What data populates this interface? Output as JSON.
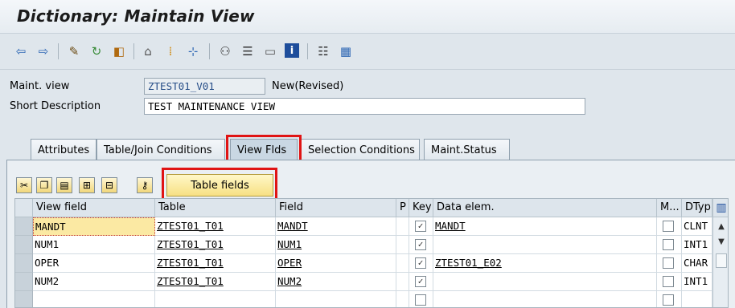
{
  "window": {
    "title": "Dictionary: Maintain View"
  },
  "toolbar": {
    "icons": [
      "back-arrow-icon",
      "forward-arrow-icon",
      "other-object-icon",
      "display-change-icon",
      "activate-icon",
      "where-used-icon",
      "object-list-icon",
      "navigation-icon",
      "hierarchy-icon",
      "technical-settings-icon",
      "documentation-icon",
      "info-icon",
      "check-icon",
      "table-view-icon"
    ]
  },
  "form": {
    "maint_view_label": "Maint. view",
    "maint_view_value": "ZTEST01_V01",
    "maint_view_status": "New(Revised)",
    "short_desc_label": "Short Description",
    "short_desc_value": "TEST MAINTENANCE VIEW"
  },
  "tabs": [
    {
      "label": "Attributes"
    },
    {
      "label": "Table/Join Conditions"
    },
    {
      "label": "View Flds"
    },
    {
      "label": "Selection Conditions"
    },
    {
      "label": "Maint.Status"
    }
  ],
  "table_toolbar": {
    "table_fields_label": "Table fields"
  },
  "grid": {
    "headers": {
      "view_field": "View field",
      "table": "Table",
      "field": "Field",
      "p": "P",
      "key": "Key",
      "data_elem": "Data elem.",
      "m": "M...",
      "dtype": "DTyp"
    },
    "rows": [
      {
        "view_field": "MANDT",
        "table": "ZTEST01_T01",
        "field": "MANDT",
        "key": true,
        "data_elem": "MANDT",
        "m": false,
        "dtype": "CLNT"
      },
      {
        "view_field": "NUM1",
        "table": "ZTEST01_T01",
        "field": "NUM1",
        "key": true,
        "data_elem": "",
        "m": false,
        "dtype": "INT1"
      },
      {
        "view_field": "OPER",
        "table": "ZTEST01_T01",
        "field": "OPER",
        "key": true,
        "data_elem": "ZTEST01_E02",
        "m": false,
        "dtype": "CHAR"
      },
      {
        "view_field": "NUM2",
        "table": "ZTEST01_T01",
        "field": "NUM2",
        "key": true,
        "data_elem": "",
        "m": false,
        "dtype": "INT1"
      },
      {
        "view_field": "",
        "table": "",
        "field": "",
        "key": false,
        "data_elem": "",
        "m": false,
        "dtype": ""
      }
    ]
  },
  "colors": {
    "highlight": "#e01414",
    "button_yellow": "#f7e083",
    "readonly_text": "#274e88"
  }
}
